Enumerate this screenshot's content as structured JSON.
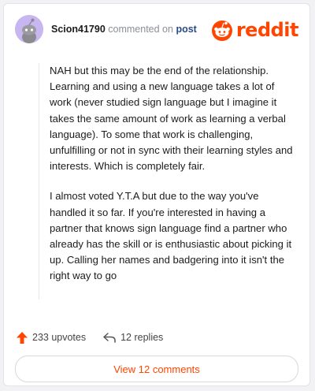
{
  "header": {
    "username": "Scion41790",
    "action": "commented on",
    "target": "post",
    "brand": "reddit"
  },
  "comment": {
    "paragraphs": [
      "NAH but this may be the end of the relationship. Learning and using a new language takes a lot of work (never studied sign language but I imagine it takes the same amount of work as learning a verbal language). To some that work is challenging, unfulfilling or not in sync with their learning styles and interests. Which is completely fair.",
      "I almost voted Y.T.A but due to the way you've handled it so far. If you're interested in having a partner that knows sign language find a partner who already has the skill or is enthusiastic about picking it up. Calling her names and badgering into it isn't the right way to go"
    ]
  },
  "footer": {
    "upvotes": "233 upvotes",
    "replies": "12 replies"
  },
  "view_button": "View 12 comments",
  "colors": {
    "accent": "#ff4500",
    "link": "#2a4b82"
  },
  "icons": [
    "snoo-avatar-icon",
    "reddit-logo-icon",
    "upvote-arrow-icon",
    "reply-arrow-icon"
  ]
}
